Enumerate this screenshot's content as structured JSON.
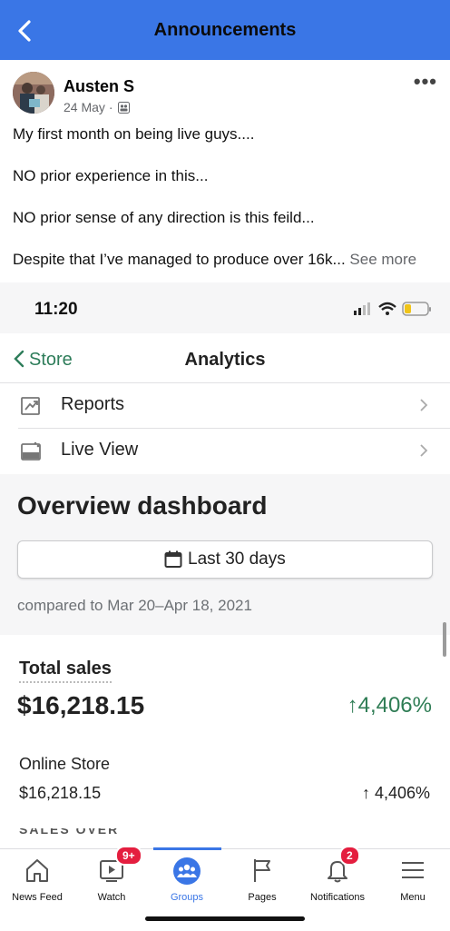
{
  "header": {
    "title": "Announcements",
    "back_icon": "chevron-left-icon"
  },
  "post": {
    "author": "Austen S",
    "date": "24 May",
    "separator": "·",
    "lines": [
      "My first month on being live guys....",
      "NO prior experience in this...",
      "NO prior sense of any direction is this feild...",
      "Despite that I’ve managed to produce over 16k..."
    ],
    "see_more": "See more"
  },
  "screenshot": {
    "status_time": "11:20",
    "back_label": "Store",
    "title": "Analytics",
    "menu": [
      {
        "label": "Reports",
        "icon": "reports-icon"
      },
      {
        "label": "Live View",
        "icon": "live-view-icon"
      }
    ],
    "overview_title": "Overview dashboard",
    "date_range": "Last 30 days",
    "compared": "compared to Mar 20–Apr 18, 2021",
    "total_sales_label": "Total sales",
    "total_sales_value": "$16,218.15",
    "total_sales_change": "↑4,406%",
    "online_store_label": "Online Store",
    "online_store_value": "$16,218.15",
    "online_store_change": "↑ 4,406%",
    "cut_off_heading": "SALES OVER TIME"
  },
  "tabs": [
    {
      "label": "News Feed",
      "icon": "home-icon"
    },
    {
      "label": "Watch",
      "icon": "watch-icon",
      "badge": "9+"
    },
    {
      "label": "Groups",
      "icon": "groups-icon",
      "active": true
    },
    {
      "label": "Pages",
      "icon": "flag-icon"
    },
    {
      "label": "Notifications",
      "icon": "bell-icon",
      "badge": "2"
    },
    {
      "label": "Menu",
      "icon": "menu-icon"
    }
  ],
  "colors": {
    "brand_blue": "#3a76e6",
    "badge_red": "#e41e3f",
    "shopify_green": "#2f7d55"
  }
}
